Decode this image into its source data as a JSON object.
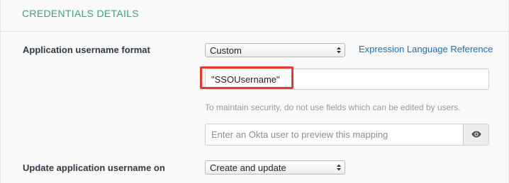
{
  "section": {
    "title": "CREDENTIALS DETAILS"
  },
  "username_format": {
    "label": "Application username format",
    "selected": "Custom",
    "link": "Expression Language Reference",
    "expression_value": "\"SSOUsername\"",
    "help": "To maintain security, do not use fields which can be edited by users.",
    "preview_placeholder": "Enter an Okta user to preview this mapping",
    "preview_button_icon": "eye-icon"
  },
  "update_on": {
    "label": "Update application username on",
    "selected": "Create and update"
  },
  "colors": {
    "section_title": "#3ba27c",
    "link": "#1b6fb5",
    "highlight": "#e53b2c",
    "help_text": "#9a9a9a"
  }
}
